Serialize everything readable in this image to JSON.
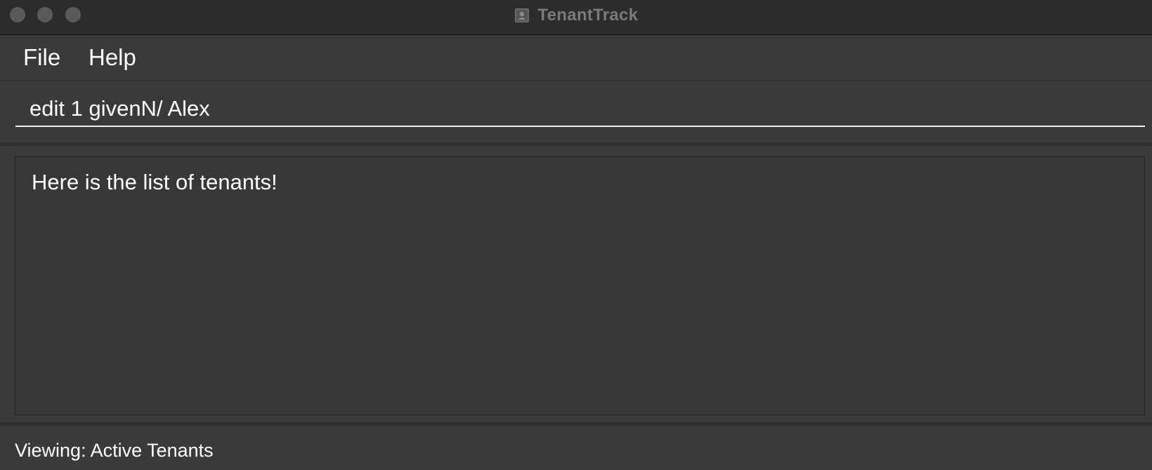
{
  "window": {
    "title": "TenantTrack",
    "app_icon": "person-card-icon"
  },
  "menu": {
    "items": [
      {
        "label": "File"
      },
      {
        "label": "Help"
      }
    ]
  },
  "command": {
    "value": "edit 1 givenN/ Alex"
  },
  "result": {
    "message": "Here is the list of tenants!"
  },
  "status": {
    "text": "Viewing: Active Tenants"
  },
  "colors": {
    "window_background": "#3a3a3a",
    "titlebar_background": "#2c2c2c",
    "text": "#ffffff",
    "title_text": "#7a7a7a"
  }
}
